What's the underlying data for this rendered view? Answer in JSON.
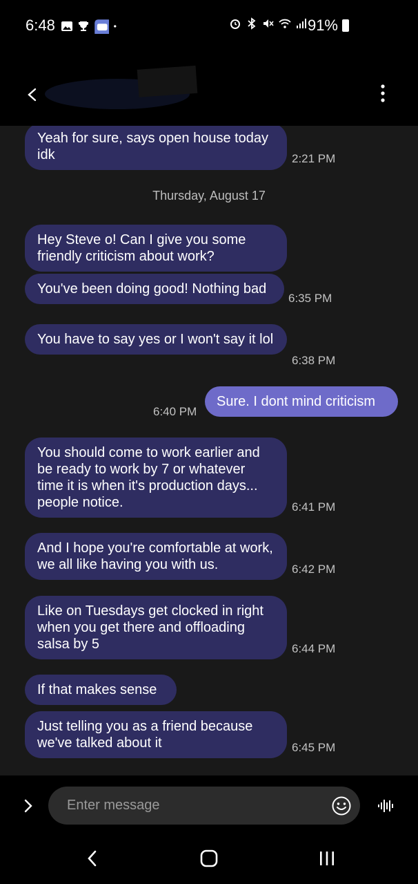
{
  "status": {
    "time": "6:48",
    "battery": "91%"
  },
  "header": {
    "contact_name_redacted": ""
  },
  "messages": [
    {
      "text": "Yeah for sure, says open house today idk",
      "time": "2:21 PM"
    },
    {
      "text": "Hey Steve o! Can I give you some friendly criticism about work?",
      "time": ""
    },
    {
      "text": "You've been doing good! Nothing bad",
      "time": "6:35 PM"
    },
    {
      "text": "You have to say yes or I won't say it lol",
      "time": "6:38 PM"
    },
    {
      "text": "Sure. I dont mind criticism",
      "time": "6:40 PM"
    },
    {
      "text": "You should come to work earlier and be ready to work by 7 or whatever time it is when it's production days... people notice.",
      "time": "6:41 PM"
    },
    {
      "text": "And I hope you're comfortable at work, we all like having you with us.",
      "time": "6:42 PM"
    },
    {
      "text": "Like on Tuesdays get clocked in right when you get there and offloading salsa by 5",
      "time": "6:44 PM"
    },
    {
      "text": "If that makes sense",
      "time": ""
    },
    {
      "text": "Just telling you as a friend because we've talked about it",
      "time": "6:45 PM"
    }
  ],
  "date_separator": "Thursday, August 17",
  "composer": {
    "placeholder": "Enter message"
  },
  "colors": {
    "incoming_bubble": "#2f2d61",
    "outgoing_bubble": "#6e6bc9",
    "chat_background": "#191919"
  },
  "icons": {
    "status_left": [
      "gallery-icon",
      "trophy-icon",
      "app-icon",
      "dot-icon"
    ],
    "status_right": [
      "alarm-icon",
      "bluetooth-icon",
      "mute-icon",
      "wifi-icon",
      "signal-icon",
      "battery-icon"
    ]
  }
}
